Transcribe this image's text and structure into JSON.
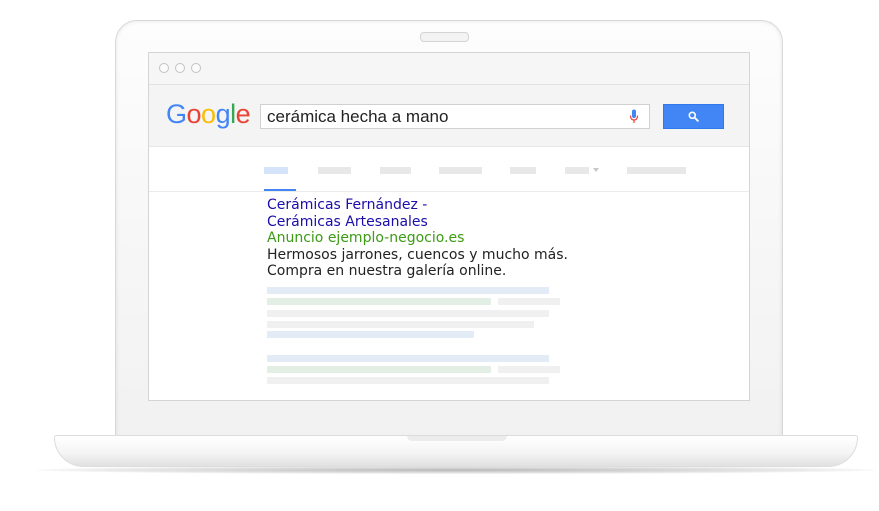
{
  "search": {
    "logo": [
      "G",
      "o",
      "o",
      "g",
      "l",
      "e"
    ],
    "logo_colors": [
      "#4285f4",
      "#ea4335",
      "#fbbc05",
      "#4285f4",
      "#34a853",
      "#ea4335"
    ],
    "query": "cerámica hecha a mano",
    "mic_icon": "microphone-icon",
    "button_icon": "magnifier-icon"
  },
  "ad": {
    "title_line1": "Cerámicas Fernández -",
    "title_line2": "Cerámicas Artesanales",
    "label": "Anuncio",
    "url": "ejemplo-negocio.es",
    "desc_line1": "Hermosos jarrones, cuencos y mucho más.",
    "desc_line2": "Compra en nuestra galería online."
  },
  "colors": {
    "link": "#1a0dab",
    "url": "#3c9a14",
    "accent": "#4285f4"
  }
}
